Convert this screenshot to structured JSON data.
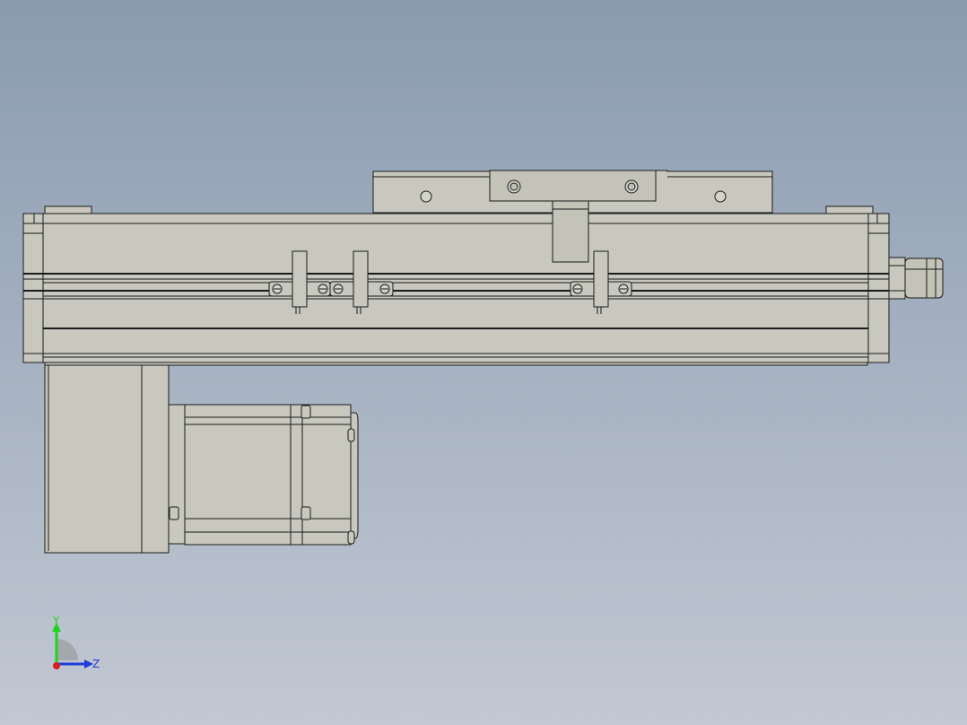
{
  "viewport": {
    "background_top": "#8a9bb0",
    "background_bottom": "#c2c8d3"
  },
  "model": {
    "face_color": "#c8c8be",
    "edge_color": "#1a1a1a",
    "shade_color": "#b9b9ae"
  },
  "triad": {
    "y_label": "Y",
    "z_label": "Z",
    "y_color": "#1bd41b",
    "z_color": "#1f3cd9",
    "x_color": "#d91f1f"
  }
}
